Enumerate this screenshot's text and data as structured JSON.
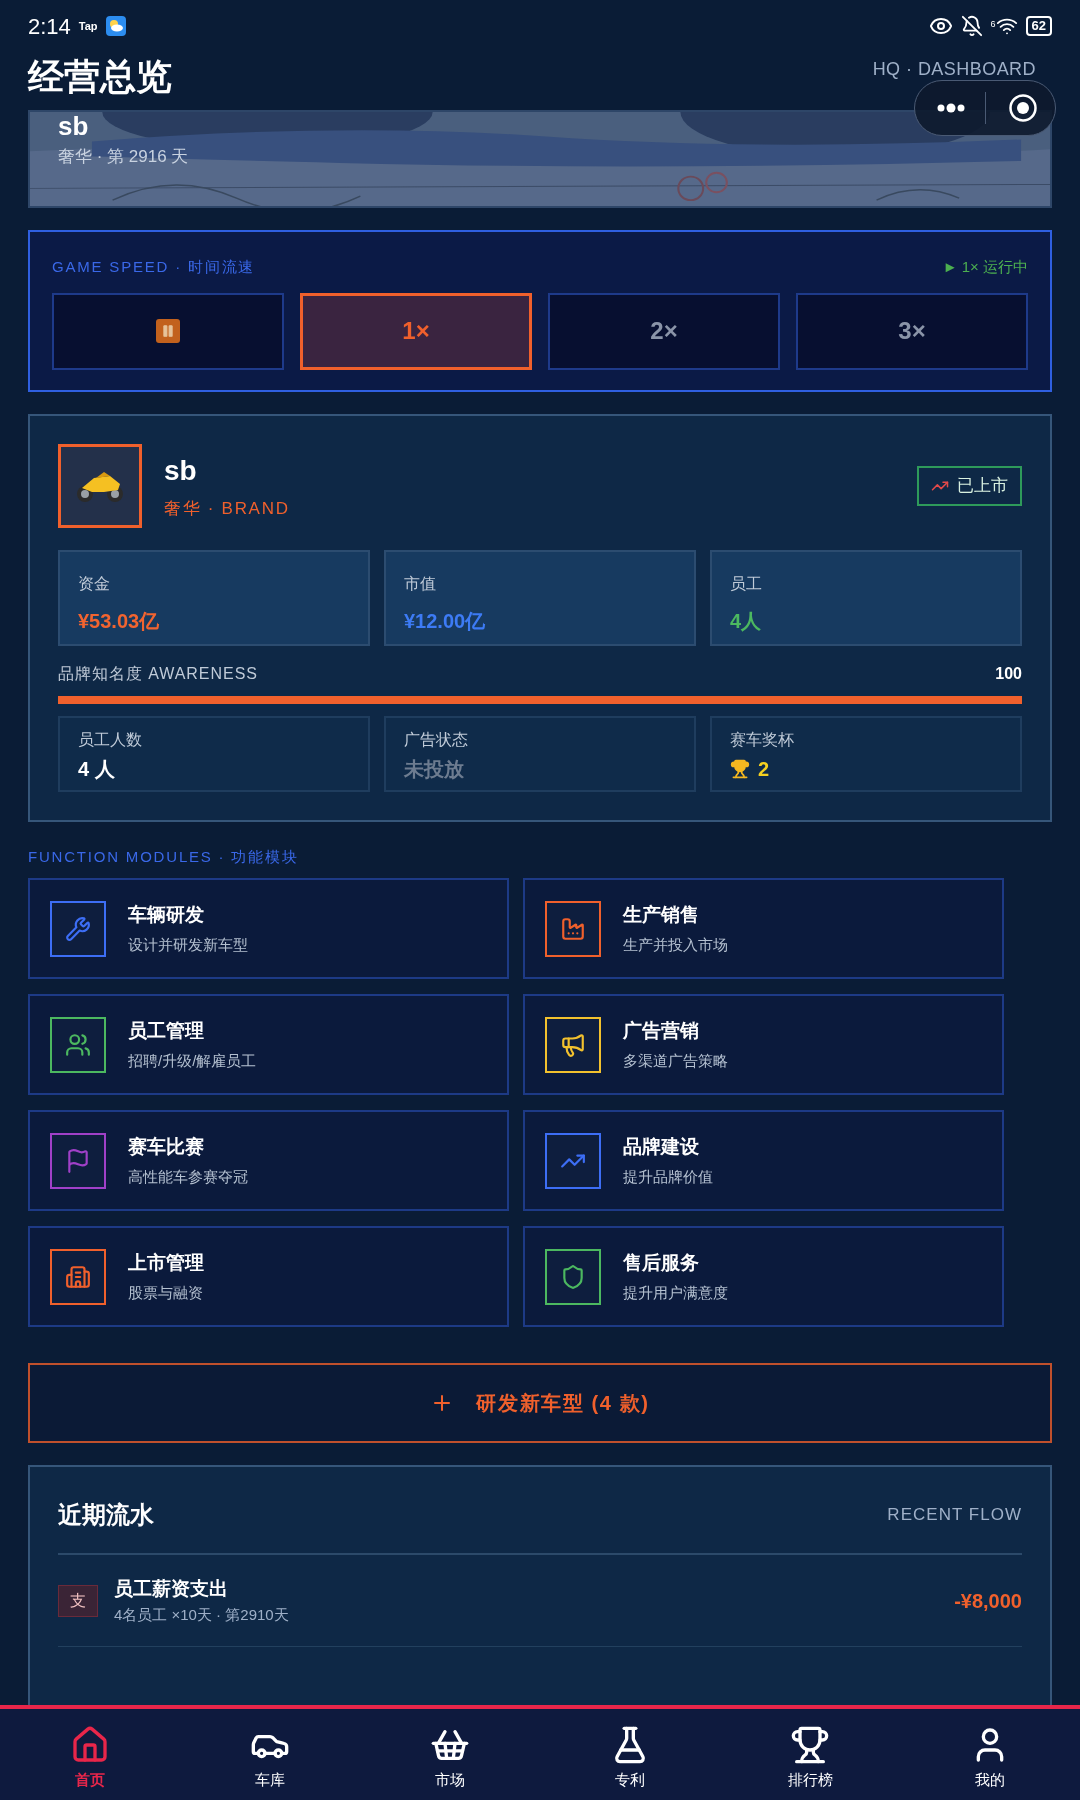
{
  "status_bar": {
    "time": "2:14",
    "app_badge": "Tap",
    "signal_label": "6",
    "battery": "62"
  },
  "header": {
    "title": "经营总览",
    "subtitle": "HQ · DASHBOARD"
  },
  "banner": {
    "name": "sb",
    "meta": "奢华 · 第 2916 天"
  },
  "game_speed": {
    "heading": "GAME SPEED · 时间流速",
    "status": "► 1× 运行中",
    "options": [
      {
        "kind": "pause",
        "selected": false
      },
      {
        "kind": "speed",
        "label": "1×",
        "selected": true
      },
      {
        "kind": "speed",
        "label": "2×",
        "selected": false
      },
      {
        "kind": "speed",
        "label": "3×",
        "selected": false
      }
    ]
  },
  "brand": {
    "name": "sb",
    "tier": "奢华 · BRAND",
    "badge": "已上市",
    "stats": [
      {
        "label": "资金",
        "value": "¥53.03亿",
        "color": "#f26430"
      },
      {
        "label": "市值",
        "value": "¥12.00亿",
        "color": "#3d7bf5"
      },
      {
        "label": "员工",
        "value": "4人",
        "color": "#4cb860"
      }
    ],
    "awareness": {
      "label": "品牌知名度 AWARENESS",
      "value": "100",
      "level": 1
    },
    "details": [
      {
        "label": "员工人数",
        "value": "4 人",
        "kind": "plain"
      },
      {
        "label": "广告状态",
        "value": "未投放",
        "kind": "muted"
      },
      {
        "label": "赛车奖杯",
        "value": "2",
        "kind": "trophy"
      }
    ]
  },
  "modules": {
    "heading": "FUNCTION MODULES · 功能模块",
    "items": [
      {
        "title": "车辆研发",
        "desc": "设计并研发新车型",
        "kind": "wrench",
        "color": "#3d6ef5"
      },
      {
        "title": "生产销售",
        "desc": "生产并投入市场",
        "kind": "factory",
        "color": "#f0602c"
      },
      {
        "title": "员工管理",
        "desc": "招聘/升级/解雇员工",
        "kind": "users",
        "color": "#4cb860"
      },
      {
        "title": "广告营销",
        "desc": "多渠道广告策略",
        "kind": "megaphone",
        "color": "#f2c12e"
      },
      {
        "title": "赛车比赛",
        "desc": "高性能车参赛夺冠",
        "kind": "flag",
        "color": "#a040c8"
      },
      {
        "title": "品牌建设",
        "desc": "提升品牌价值",
        "kind": "trend",
        "color": "#3d6ef5"
      },
      {
        "title": "上市管理",
        "desc": "股票与融资",
        "kind": "building",
        "color": "#f0602c"
      },
      {
        "title": "售后服务",
        "desc": "提升用户满意度",
        "kind": "shield",
        "color": "#4cb860"
      }
    ]
  },
  "develop_button": {
    "label": "研发新车型 (4 款)"
  },
  "recent_flow": {
    "title": "近期流水",
    "subtitle": "RECENT FLOW",
    "rows": [
      {
        "badge": "支",
        "title": "员工薪资支出",
        "meta": "4名员工 ×10天 · 第2910天",
        "amount": "-¥8,000"
      }
    ]
  },
  "nav": [
    {
      "label": "首页",
      "kind": "home",
      "selected": true
    },
    {
      "label": "车库",
      "kind": "car",
      "selected": false
    },
    {
      "label": "市场",
      "kind": "basket",
      "selected": false
    },
    {
      "label": "专利",
      "kind": "flask",
      "selected": false
    },
    {
      "label": "排行榜",
      "kind": "trophy",
      "selected": false
    },
    {
      "label": "我的",
      "kind": "user",
      "selected": false
    }
  ]
}
